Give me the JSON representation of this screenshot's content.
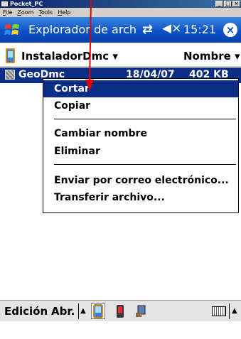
{
  "window": {
    "title": "Pocket_PC",
    "menu": [
      "File",
      "Zoom",
      "Tools",
      "Help"
    ],
    "controls": [
      "_",
      "□",
      "×"
    ]
  },
  "navbar": {
    "title": "Explorador de arch",
    "time": "15:21",
    "icons": [
      "start-flag-icon",
      "sync-icon",
      "volume-icon",
      "close-icon"
    ]
  },
  "folder": {
    "name": "InstaladorDmc",
    "sort": "Nombre"
  },
  "file": {
    "name": "GeoDmc",
    "date": "18/04/07",
    "size": "402 KB"
  },
  "context_menu": {
    "items": [
      "Cortar",
      "Copiar",
      "Cambiar nombre",
      "Eliminar",
      "Enviar por correo electrónico...",
      "Transferir archivo..."
    ],
    "selected_index": 0
  },
  "menubar": {
    "left": "Edición",
    "right": "Abr."
  },
  "colors": {
    "nav_blue": "#0c52c8",
    "selection": "#0a2d86",
    "arrow": "#e00000"
  }
}
